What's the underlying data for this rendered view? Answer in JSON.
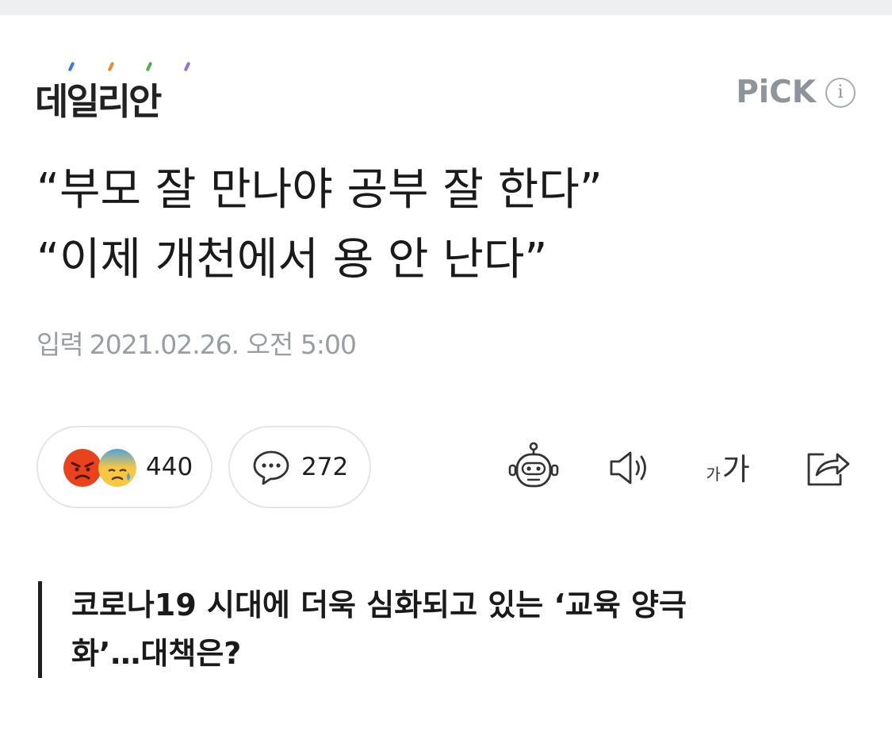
{
  "header": {
    "logo_text": "데일리안",
    "logo_tick_colors": [
      "#3a7bd5",
      "#f08a2c",
      "#4caf50",
      "#9c6ad6"
    ],
    "pick_label": "PiCK",
    "pick_info_glyph": "i"
  },
  "article": {
    "headline_lines": [
      "“부모 잘 만나야 공부 잘 한다”",
      "“이제 개천에서 용 안 난다”"
    ],
    "published_label": "입력",
    "published_datetime": "2021.02.26. 오전 5:00"
  },
  "actions": {
    "reactions_count": "440",
    "reaction_icons": [
      "angry-face-icon",
      "sweat-face-icon"
    ],
    "comments_count": "272",
    "font_size_label_small": "가",
    "font_size_label_large": "가"
  },
  "subtitle_lines": [
    "코로나19 시대에 더욱 심화되고 있는 ‘교육 양극",
    "화’…대책은?"
  ],
  "colors": {
    "text": "#1f1f1f",
    "muted": "#9a9ea3",
    "pick": "#8f949a",
    "pill_border": "#e4e5e7"
  }
}
